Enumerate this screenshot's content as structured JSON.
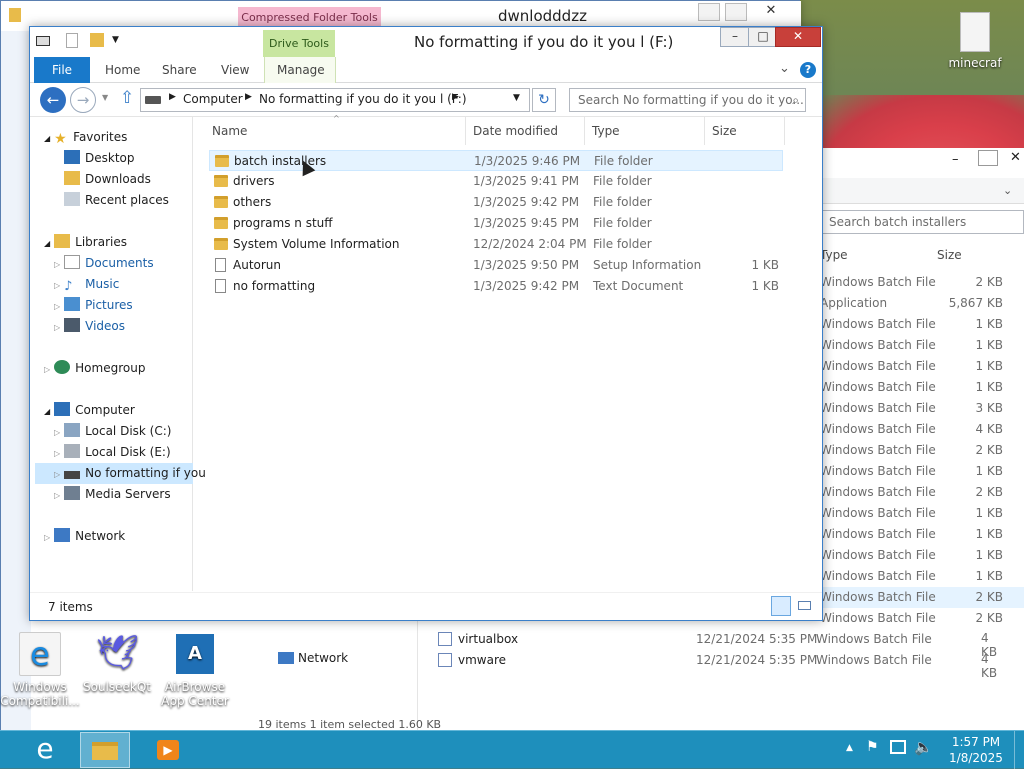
{
  "back_window": {
    "context_tab": "Compressed Folder Tools",
    "title": "dwnlodddzz",
    "search_placeholder": "Search batch installers",
    "col_type": "Type",
    "col_size": "Size",
    "rows": [
      {
        "type": "Windows Batch File",
        "size": "2 KB"
      },
      {
        "type": "Application",
        "size": "5,867 KB"
      },
      {
        "type": "Windows Batch File",
        "size": "1 KB"
      },
      {
        "type": "Windows Batch File",
        "size": "1 KB"
      },
      {
        "type": "Windows Batch File",
        "size": "1 KB"
      },
      {
        "type": "Windows Batch File",
        "size": "1 KB"
      },
      {
        "type": "Windows Batch File",
        "size": "3 KB"
      },
      {
        "type": "Windows Batch File",
        "size": "4 KB"
      },
      {
        "type": "Windows Batch File",
        "size": "2 KB"
      },
      {
        "type": "Windows Batch File",
        "size": "1 KB"
      },
      {
        "type": "Windows Batch File",
        "size": "2 KB"
      },
      {
        "type": "Windows Batch File",
        "size": "1 KB"
      },
      {
        "type": "Windows Batch File",
        "size": "1 KB"
      },
      {
        "type": "Windows Batch File",
        "size": "1 KB"
      },
      {
        "type": "Windows Batch File",
        "size": "1 KB"
      },
      {
        "type": "Windows Batch File",
        "size": "2 KB"
      },
      {
        "type": "Windows Batch File",
        "size": "2 KB"
      }
    ],
    "lower_rows": [
      {
        "name": "virtualbox",
        "date": "12/21/2024 5:35 PM",
        "type": "Windows Batch File",
        "size": "4 KB"
      },
      {
        "name": "vmware",
        "date": "12/21/2024 5:35 PM",
        "type": "Windows Batch File",
        "size": "4 KB"
      }
    ],
    "network_label": "Network",
    "status": "19 items    1 item selected  1.60 KB"
  },
  "window": {
    "context_tab": "Drive Tools",
    "title": "No formatting if you do it you l (F:)",
    "tabs": {
      "file": "File",
      "home": "Home",
      "share": "Share",
      "view": "View",
      "manage": "Manage"
    },
    "address": {
      "root": "Computer",
      "drive": "No formatting if you do it you l (F:)"
    },
    "search_placeholder": "Search No formatting if you do it yo...",
    "columns": {
      "name": "Name",
      "date": "Date modified",
      "type": "Type",
      "size": "Size"
    },
    "files": [
      {
        "name": "batch installers",
        "date": "1/3/2025 9:46 PM",
        "type": "File folder",
        "size": ""
      },
      {
        "name": "drivers",
        "date": "1/3/2025 9:41 PM",
        "type": "File folder",
        "size": ""
      },
      {
        "name": "others",
        "date": "1/3/2025 9:42 PM",
        "type": "File folder",
        "size": ""
      },
      {
        "name": "programs n stuff",
        "date": "1/3/2025 9:45 PM",
        "type": "File folder",
        "size": ""
      },
      {
        "name": "System Volume Information",
        "date": "12/2/2024 2:04 PM",
        "type": "File folder",
        "size": ""
      },
      {
        "name": "Autorun",
        "date": "1/3/2025 9:50 PM",
        "type": "Setup Information",
        "size": "1 KB"
      },
      {
        "name": "no formatting",
        "date": "1/3/2025 9:42 PM",
        "type": "Text Document",
        "size": "1 KB"
      }
    ],
    "nav": {
      "favorites": "Favorites",
      "desktop": "Desktop",
      "downloads": "Downloads",
      "recent": "Recent places",
      "libraries": "Libraries",
      "documents": "Documents",
      "music": "Music",
      "pictures": "Pictures",
      "videos": "Videos",
      "homegroup": "Homegroup",
      "computer": "Computer",
      "c": "Local Disk (C:)",
      "e": "Local Disk (E:)",
      "f": "No formatting if you",
      "media": "Media Servers",
      "network": "Network"
    },
    "status": "7 items"
  },
  "desktop_icons": {
    "minecraft": "minecraf",
    "compat_1": "Windows",
    "compat_2": "Compatibili...",
    "soulseek": "SoulseekQt",
    "airbrowse_1": "AirBrowse",
    "airbrowse_2": "App Center"
  },
  "clock": {
    "time": "1:57 PM",
    "date": "1/8/2025"
  },
  "colors": {
    "accent": "#1979ca",
    "taskbar": "#1e8fbc",
    "context_tab": "#c8e6a0",
    "compressed_tab": "#f5b8cf"
  }
}
